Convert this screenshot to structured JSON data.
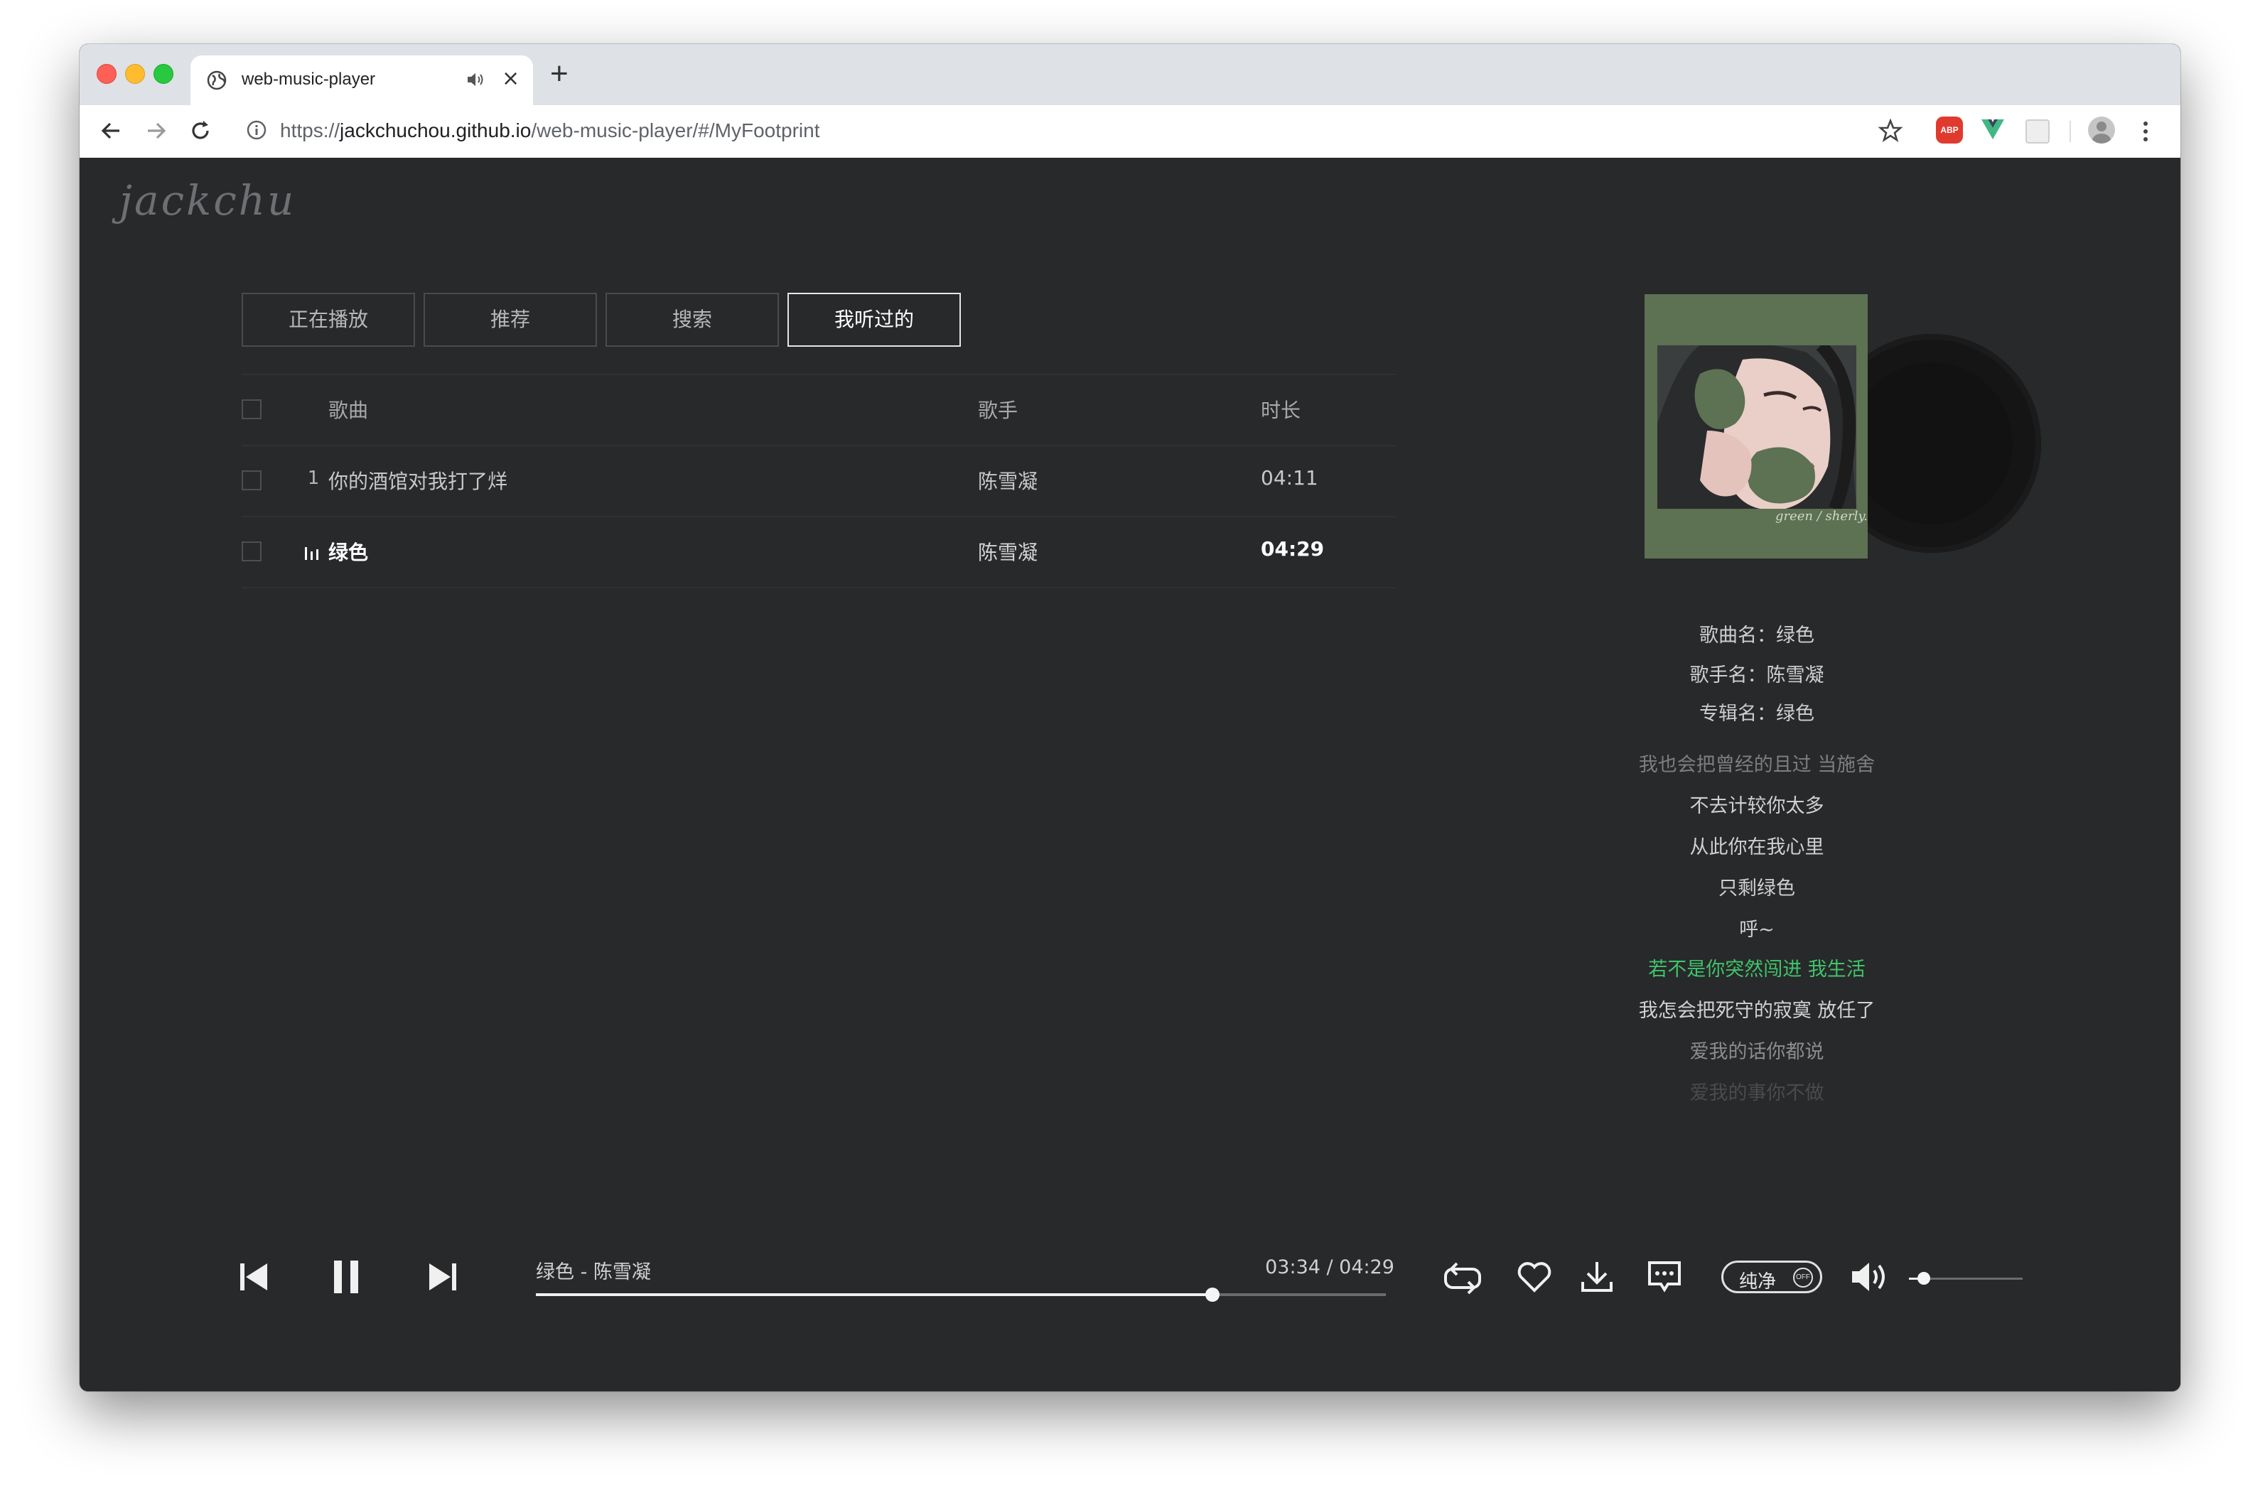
{
  "browser": {
    "tab_title": "web-music-player",
    "url_prefix": "https://",
    "url_host": "jackchuchou.github.io",
    "url_path": "/web-music-player/#/MyFootprint",
    "extension_abp": "ABP"
  },
  "app": {
    "logo": "jackchu",
    "nav_tabs": [
      "正在播放",
      "推荐",
      "搜索",
      "我听过的"
    ],
    "active_tab": "我听过的",
    "table": {
      "headers": {
        "song": "歌曲",
        "artist": "歌手",
        "duration": "时长"
      },
      "rows": [
        {
          "index": "1",
          "song": "你的酒馆对我打了烊",
          "artist": "陈雪凝",
          "duration": "04:11",
          "playing": false
        },
        {
          "index": "",
          "song": "绿色",
          "artist": "陈雪凝",
          "duration": "04:29",
          "playing": true
        }
      ]
    },
    "song_info": {
      "song_label": "歌曲名：",
      "song_value": "绿色",
      "artist_label": "歌手名：",
      "artist_value": "陈雪凝",
      "album_label": "专辑名：",
      "album_value": "绿色"
    },
    "album_cover_signature": "green / sherly.",
    "lyrics": [
      {
        "text": "我也会把曾经的且过 当施舍",
        "state": "past"
      },
      {
        "text": "不去计较你太多",
        "state": "normal"
      },
      {
        "text": "从此你在我心里",
        "state": "normal"
      },
      {
        "text": "只剩绿色",
        "state": "normal"
      },
      {
        "text": "呼~",
        "state": "normal"
      },
      {
        "text": "若不是你突然闯进 我生活",
        "state": "current"
      },
      {
        "text": "我怎会把死守的寂寞 放任了",
        "state": "normal"
      },
      {
        "text": "爱我的话你都说",
        "state": "dim"
      },
      {
        "text": "爱我的事你不做",
        "state": "faint"
      }
    ],
    "colors": {
      "background": "#28292b",
      "current_lyric": "#3fc46a",
      "album_green": "#5d7153"
    },
    "player": {
      "now_playing": "绿色 - 陈雪凝",
      "time": "03:34 / 04:29",
      "progress": 0.796,
      "volume": 0.13,
      "pure_mode_label": "纯净",
      "pure_mode_state": "OFF",
      "icons": [
        "previous-icon",
        "pause-icon",
        "next-icon",
        "loop-icon",
        "heart-icon",
        "download-icon",
        "comment-icon",
        "volume-icon"
      ]
    }
  }
}
